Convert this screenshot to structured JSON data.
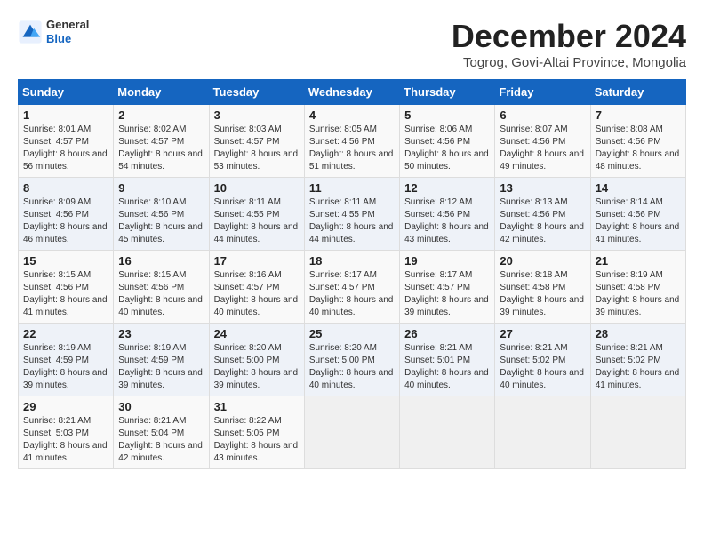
{
  "logo": {
    "general": "General",
    "blue": "Blue"
  },
  "title": "December 2024",
  "subtitle": "Togrog, Govi-Altai Province, Mongolia",
  "calendar": {
    "headers": [
      "Sunday",
      "Monday",
      "Tuesday",
      "Wednesday",
      "Thursday",
      "Friday",
      "Saturday"
    ],
    "rows": [
      [
        {
          "day": "1",
          "info": "Sunrise: 8:01 AM\nSunset: 4:57 PM\nDaylight: 8 hours and 56 minutes."
        },
        {
          "day": "2",
          "info": "Sunrise: 8:02 AM\nSunset: 4:57 PM\nDaylight: 8 hours and 54 minutes."
        },
        {
          "day": "3",
          "info": "Sunrise: 8:03 AM\nSunset: 4:57 PM\nDaylight: 8 hours and 53 minutes."
        },
        {
          "day": "4",
          "info": "Sunrise: 8:05 AM\nSunset: 4:56 PM\nDaylight: 8 hours and 51 minutes."
        },
        {
          "day": "5",
          "info": "Sunrise: 8:06 AM\nSunset: 4:56 PM\nDaylight: 8 hours and 50 minutes."
        },
        {
          "day": "6",
          "info": "Sunrise: 8:07 AM\nSunset: 4:56 PM\nDaylight: 8 hours and 49 minutes."
        },
        {
          "day": "7",
          "info": "Sunrise: 8:08 AM\nSunset: 4:56 PM\nDaylight: 8 hours and 48 minutes."
        }
      ],
      [
        {
          "day": "8",
          "info": "Sunrise: 8:09 AM\nSunset: 4:56 PM\nDaylight: 8 hours and 46 minutes."
        },
        {
          "day": "9",
          "info": "Sunrise: 8:10 AM\nSunset: 4:56 PM\nDaylight: 8 hours and 45 minutes."
        },
        {
          "day": "10",
          "info": "Sunrise: 8:11 AM\nSunset: 4:55 PM\nDaylight: 8 hours and 44 minutes."
        },
        {
          "day": "11",
          "info": "Sunrise: 8:11 AM\nSunset: 4:55 PM\nDaylight: 8 hours and 44 minutes."
        },
        {
          "day": "12",
          "info": "Sunrise: 8:12 AM\nSunset: 4:56 PM\nDaylight: 8 hours and 43 minutes."
        },
        {
          "day": "13",
          "info": "Sunrise: 8:13 AM\nSunset: 4:56 PM\nDaylight: 8 hours and 42 minutes."
        },
        {
          "day": "14",
          "info": "Sunrise: 8:14 AM\nSunset: 4:56 PM\nDaylight: 8 hours and 41 minutes."
        }
      ],
      [
        {
          "day": "15",
          "info": "Sunrise: 8:15 AM\nSunset: 4:56 PM\nDaylight: 8 hours and 41 minutes."
        },
        {
          "day": "16",
          "info": "Sunrise: 8:15 AM\nSunset: 4:56 PM\nDaylight: 8 hours and 40 minutes."
        },
        {
          "day": "17",
          "info": "Sunrise: 8:16 AM\nSunset: 4:57 PM\nDaylight: 8 hours and 40 minutes."
        },
        {
          "day": "18",
          "info": "Sunrise: 8:17 AM\nSunset: 4:57 PM\nDaylight: 8 hours and 40 minutes."
        },
        {
          "day": "19",
          "info": "Sunrise: 8:17 AM\nSunset: 4:57 PM\nDaylight: 8 hours and 39 minutes."
        },
        {
          "day": "20",
          "info": "Sunrise: 8:18 AM\nSunset: 4:58 PM\nDaylight: 8 hours and 39 minutes."
        },
        {
          "day": "21",
          "info": "Sunrise: 8:19 AM\nSunset: 4:58 PM\nDaylight: 8 hours and 39 minutes."
        }
      ],
      [
        {
          "day": "22",
          "info": "Sunrise: 8:19 AM\nSunset: 4:59 PM\nDaylight: 8 hours and 39 minutes."
        },
        {
          "day": "23",
          "info": "Sunrise: 8:19 AM\nSunset: 4:59 PM\nDaylight: 8 hours and 39 minutes."
        },
        {
          "day": "24",
          "info": "Sunrise: 8:20 AM\nSunset: 5:00 PM\nDaylight: 8 hours and 39 minutes."
        },
        {
          "day": "25",
          "info": "Sunrise: 8:20 AM\nSunset: 5:00 PM\nDaylight: 8 hours and 40 minutes."
        },
        {
          "day": "26",
          "info": "Sunrise: 8:21 AM\nSunset: 5:01 PM\nDaylight: 8 hours and 40 minutes."
        },
        {
          "day": "27",
          "info": "Sunrise: 8:21 AM\nSunset: 5:02 PM\nDaylight: 8 hours and 40 minutes."
        },
        {
          "day": "28",
          "info": "Sunrise: 8:21 AM\nSunset: 5:02 PM\nDaylight: 8 hours and 41 minutes."
        }
      ],
      [
        {
          "day": "29",
          "info": "Sunrise: 8:21 AM\nSunset: 5:03 PM\nDaylight: 8 hours and 41 minutes."
        },
        {
          "day": "30",
          "info": "Sunrise: 8:21 AM\nSunset: 5:04 PM\nDaylight: 8 hours and 42 minutes."
        },
        {
          "day": "31",
          "info": "Sunrise: 8:22 AM\nSunset: 5:05 PM\nDaylight: 8 hours and 43 minutes."
        },
        {
          "day": "",
          "info": ""
        },
        {
          "day": "",
          "info": ""
        },
        {
          "day": "",
          "info": ""
        },
        {
          "day": "",
          "info": ""
        }
      ]
    ]
  }
}
